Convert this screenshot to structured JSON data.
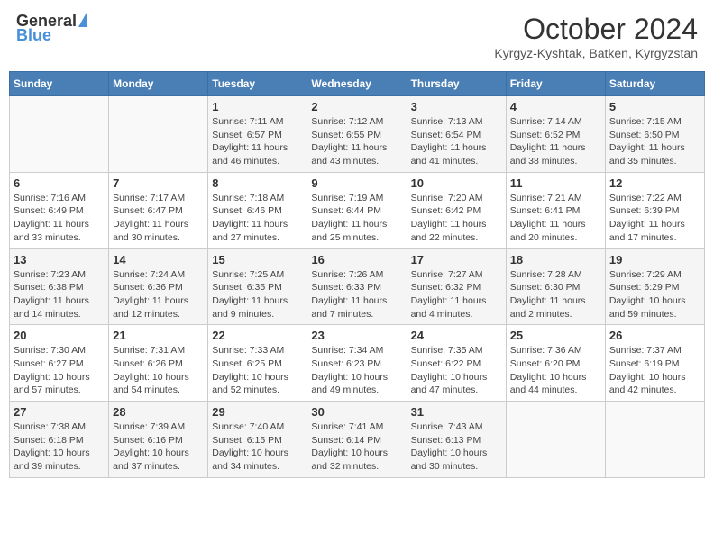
{
  "header": {
    "logo_general": "General",
    "logo_blue": "Blue",
    "month_title": "October 2024",
    "location": "Kyrgyz-Kyshtak, Batken, Kyrgyzstan"
  },
  "days_of_week": [
    "Sunday",
    "Monday",
    "Tuesday",
    "Wednesday",
    "Thursday",
    "Friday",
    "Saturday"
  ],
  "weeks": [
    [
      {
        "day": "",
        "info": ""
      },
      {
        "day": "",
        "info": ""
      },
      {
        "day": "1",
        "info": "Sunrise: 7:11 AM\nSunset: 6:57 PM\nDaylight: 11 hours and 46 minutes."
      },
      {
        "day": "2",
        "info": "Sunrise: 7:12 AM\nSunset: 6:55 PM\nDaylight: 11 hours and 43 minutes."
      },
      {
        "day": "3",
        "info": "Sunrise: 7:13 AM\nSunset: 6:54 PM\nDaylight: 11 hours and 41 minutes."
      },
      {
        "day": "4",
        "info": "Sunrise: 7:14 AM\nSunset: 6:52 PM\nDaylight: 11 hours and 38 minutes."
      },
      {
        "day": "5",
        "info": "Sunrise: 7:15 AM\nSunset: 6:50 PM\nDaylight: 11 hours and 35 minutes."
      }
    ],
    [
      {
        "day": "6",
        "info": "Sunrise: 7:16 AM\nSunset: 6:49 PM\nDaylight: 11 hours and 33 minutes."
      },
      {
        "day": "7",
        "info": "Sunrise: 7:17 AM\nSunset: 6:47 PM\nDaylight: 11 hours and 30 minutes."
      },
      {
        "day": "8",
        "info": "Sunrise: 7:18 AM\nSunset: 6:46 PM\nDaylight: 11 hours and 27 minutes."
      },
      {
        "day": "9",
        "info": "Sunrise: 7:19 AM\nSunset: 6:44 PM\nDaylight: 11 hours and 25 minutes."
      },
      {
        "day": "10",
        "info": "Sunrise: 7:20 AM\nSunset: 6:42 PM\nDaylight: 11 hours and 22 minutes."
      },
      {
        "day": "11",
        "info": "Sunrise: 7:21 AM\nSunset: 6:41 PM\nDaylight: 11 hours and 20 minutes."
      },
      {
        "day": "12",
        "info": "Sunrise: 7:22 AM\nSunset: 6:39 PM\nDaylight: 11 hours and 17 minutes."
      }
    ],
    [
      {
        "day": "13",
        "info": "Sunrise: 7:23 AM\nSunset: 6:38 PM\nDaylight: 11 hours and 14 minutes."
      },
      {
        "day": "14",
        "info": "Sunrise: 7:24 AM\nSunset: 6:36 PM\nDaylight: 11 hours and 12 minutes."
      },
      {
        "day": "15",
        "info": "Sunrise: 7:25 AM\nSunset: 6:35 PM\nDaylight: 11 hours and 9 minutes."
      },
      {
        "day": "16",
        "info": "Sunrise: 7:26 AM\nSunset: 6:33 PM\nDaylight: 11 hours and 7 minutes."
      },
      {
        "day": "17",
        "info": "Sunrise: 7:27 AM\nSunset: 6:32 PM\nDaylight: 11 hours and 4 minutes."
      },
      {
        "day": "18",
        "info": "Sunrise: 7:28 AM\nSunset: 6:30 PM\nDaylight: 11 hours and 2 minutes."
      },
      {
        "day": "19",
        "info": "Sunrise: 7:29 AM\nSunset: 6:29 PM\nDaylight: 10 hours and 59 minutes."
      }
    ],
    [
      {
        "day": "20",
        "info": "Sunrise: 7:30 AM\nSunset: 6:27 PM\nDaylight: 10 hours and 57 minutes."
      },
      {
        "day": "21",
        "info": "Sunrise: 7:31 AM\nSunset: 6:26 PM\nDaylight: 10 hours and 54 minutes."
      },
      {
        "day": "22",
        "info": "Sunrise: 7:33 AM\nSunset: 6:25 PM\nDaylight: 10 hours and 52 minutes."
      },
      {
        "day": "23",
        "info": "Sunrise: 7:34 AM\nSunset: 6:23 PM\nDaylight: 10 hours and 49 minutes."
      },
      {
        "day": "24",
        "info": "Sunrise: 7:35 AM\nSunset: 6:22 PM\nDaylight: 10 hours and 47 minutes."
      },
      {
        "day": "25",
        "info": "Sunrise: 7:36 AM\nSunset: 6:20 PM\nDaylight: 10 hours and 44 minutes."
      },
      {
        "day": "26",
        "info": "Sunrise: 7:37 AM\nSunset: 6:19 PM\nDaylight: 10 hours and 42 minutes."
      }
    ],
    [
      {
        "day": "27",
        "info": "Sunrise: 7:38 AM\nSunset: 6:18 PM\nDaylight: 10 hours and 39 minutes."
      },
      {
        "day": "28",
        "info": "Sunrise: 7:39 AM\nSunset: 6:16 PM\nDaylight: 10 hours and 37 minutes."
      },
      {
        "day": "29",
        "info": "Sunrise: 7:40 AM\nSunset: 6:15 PM\nDaylight: 10 hours and 34 minutes."
      },
      {
        "day": "30",
        "info": "Sunrise: 7:41 AM\nSunset: 6:14 PM\nDaylight: 10 hours and 32 minutes."
      },
      {
        "day": "31",
        "info": "Sunrise: 7:43 AM\nSunset: 6:13 PM\nDaylight: 10 hours and 30 minutes."
      },
      {
        "day": "",
        "info": ""
      },
      {
        "day": "",
        "info": ""
      }
    ]
  ]
}
